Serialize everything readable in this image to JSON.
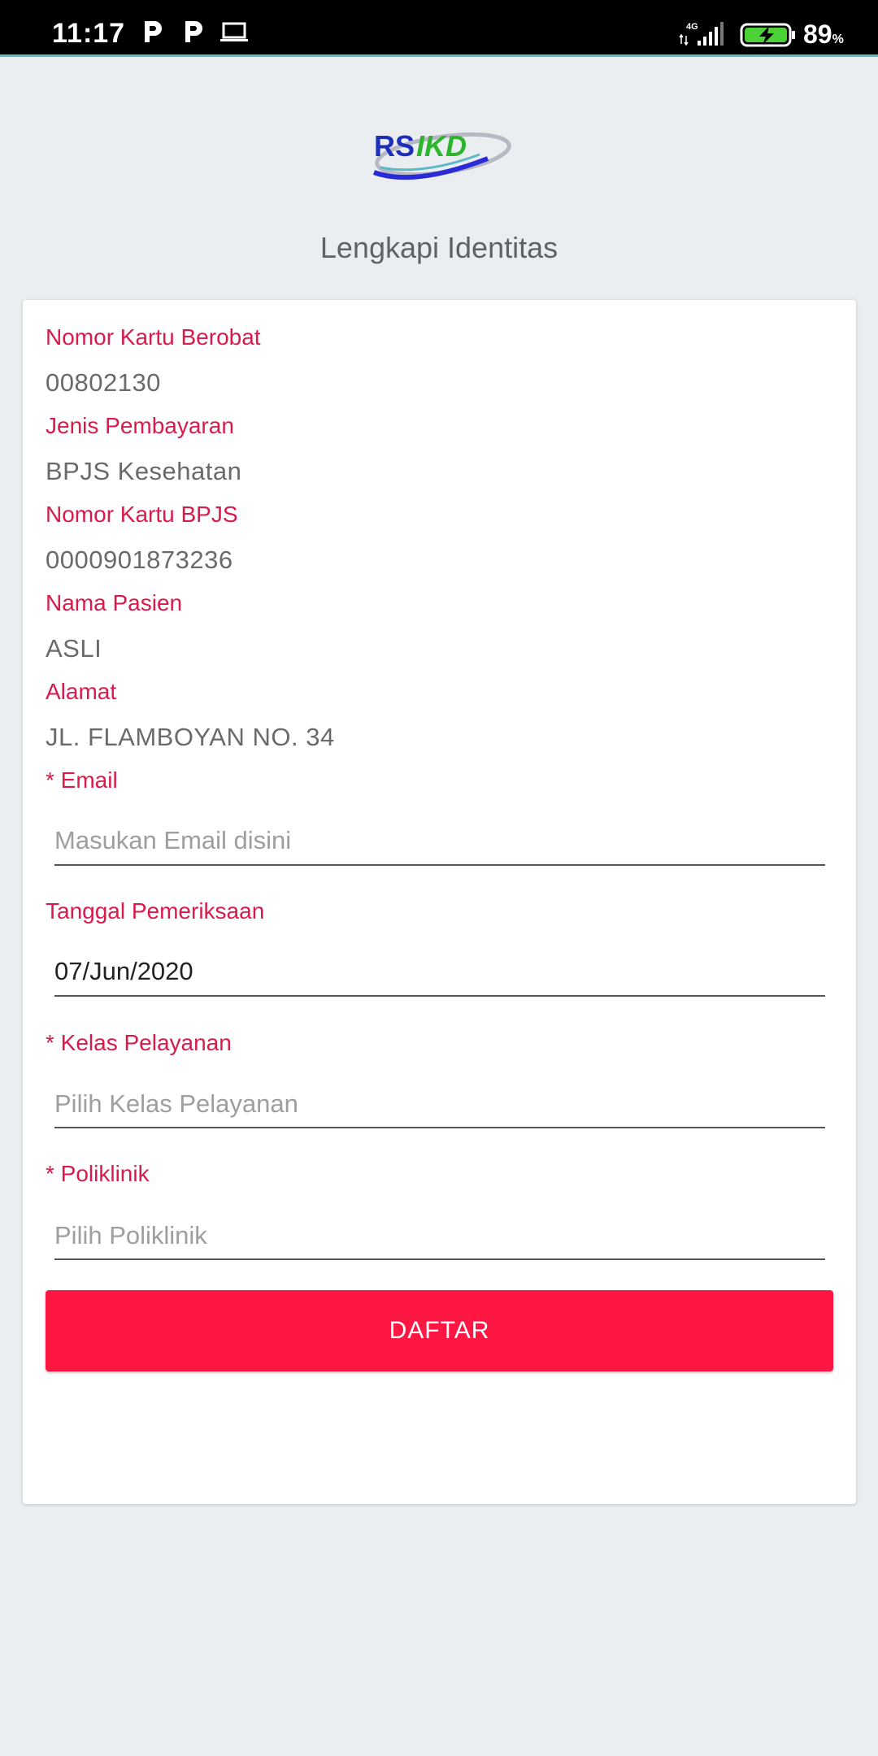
{
  "status_bar": {
    "time": "11:17",
    "network": "4G",
    "battery_level": "89",
    "battery_unit": "%"
  },
  "brand": {
    "logo_text": "RSIKD"
  },
  "page": {
    "title": "Lengkapi Identitas"
  },
  "form": {
    "card_number": {
      "label": "Nomor Kartu Berobat",
      "value": "00802130"
    },
    "payment_type": {
      "label": "Jenis Pembayaran",
      "value": "BPJS Kesehatan"
    },
    "bpjs_number": {
      "label": "Nomor Kartu BPJS",
      "value": "0000901873236"
    },
    "patient_name": {
      "label": "Nama Pasien",
      "value": "ASLI"
    },
    "address": {
      "label": "Alamat",
      "value": "JL. FLAMBOYAN NO. 34"
    },
    "email": {
      "label": "* Email",
      "placeholder": "Masukan Email disini",
      "value": ""
    },
    "exam_date": {
      "label": "Tanggal Pemeriksaan",
      "value": "07/Jun/2020"
    },
    "service_class": {
      "label": "* Kelas Pelayanan",
      "placeholder": "Pilih Kelas Pelayanan"
    },
    "clinic": {
      "label": "* Poliklinik",
      "placeholder": "Pilih Poliklinik"
    },
    "submit_label": "DAFTAR"
  },
  "colors": {
    "label": "#d81b4b",
    "button": "#ff1744",
    "background": "#eaeef1"
  }
}
